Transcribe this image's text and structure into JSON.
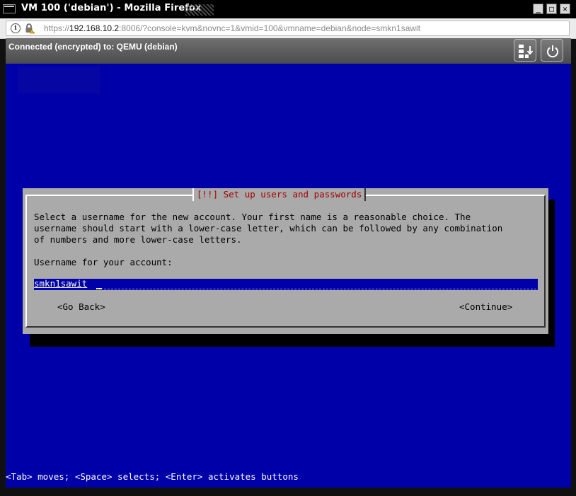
{
  "window": {
    "title": "VM 100 ('debian') - Mozilla Firefox",
    "controls": {
      "minimize": "_",
      "maximize": "□",
      "close": "✕"
    }
  },
  "urlbar": {
    "prefix": "https://",
    "host": "192.168.10.2",
    "rest": ":8006/?console=kvm&novnc=1&vmid=100&vmname=debian&node=smkn1sawit"
  },
  "novnc": {
    "status": "Connected (encrypted) to: QEMU (debian)",
    "buttons": [
      "send-keys-icon",
      "power-icon"
    ]
  },
  "installer": {
    "dialog_title": "[!!] Set up users and passwords",
    "description": "Select a username for the new account. Your first name is a reasonable choice. The\nusername should start with a lower-case letter, which can be followed by any combination\nof numbers and more lower-case letters.",
    "field_label": "Username for your account:",
    "username_value": "smkn1sawit",
    "go_back": "<Go Back>",
    "continue": "<Continue>",
    "help_line": "<Tab> moves; <Space> selects; <Enter> activates buttons"
  },
  "colors": {
    "screen_bg": "#0000a8",
    "dialog_bg": "#aaaaaa",
    "title_text": "#a00000"
  }
}
